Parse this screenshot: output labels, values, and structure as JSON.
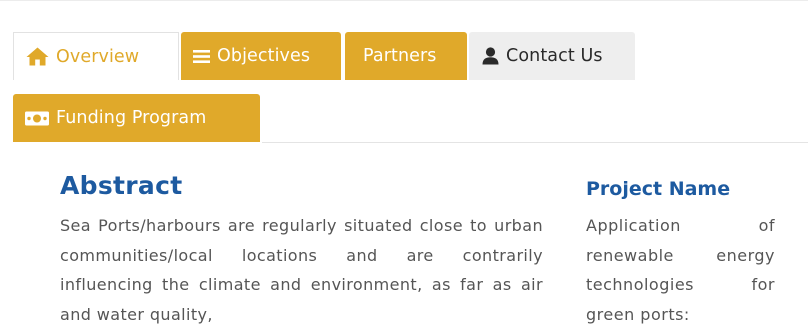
{
  "tabs": {
    "overview": {
      "label": "Overview",
      "icon": "home-icon"
    },
    "objectives": {
      "label": "Objectives",
      "icon": "list-icon"
    },
    "partners": {
      "label": "Partners"
    },
    "contact": {
      "label": "Contact Us",
      "icon": "user-icon"
    },
    "funding": {
      "label": "Funding Program",
      "icon": "money-icon"
    }
  },
  "abstract": {
    "title": "Abstract",
    "lines": [
      "Sea Ports/harbours are regularly situated",
      "close to urban communities/local locations",
      "and are contrarily influencing the climate and",
      "environment, as far as air and water quality,"
    ]
  },
  "project": {
    "title": "Project Name",
    "lines": [
      "Application of",
      "renewable energy",
      "technologies for",
      "green ports:"
    ]
  },
  "colors": {
    "accent": "#e0a92a",
    "heading": "#1d5aa0",
    "body_text": "#555555",
    "tab_grey": "#eeeeee"
  }
}
